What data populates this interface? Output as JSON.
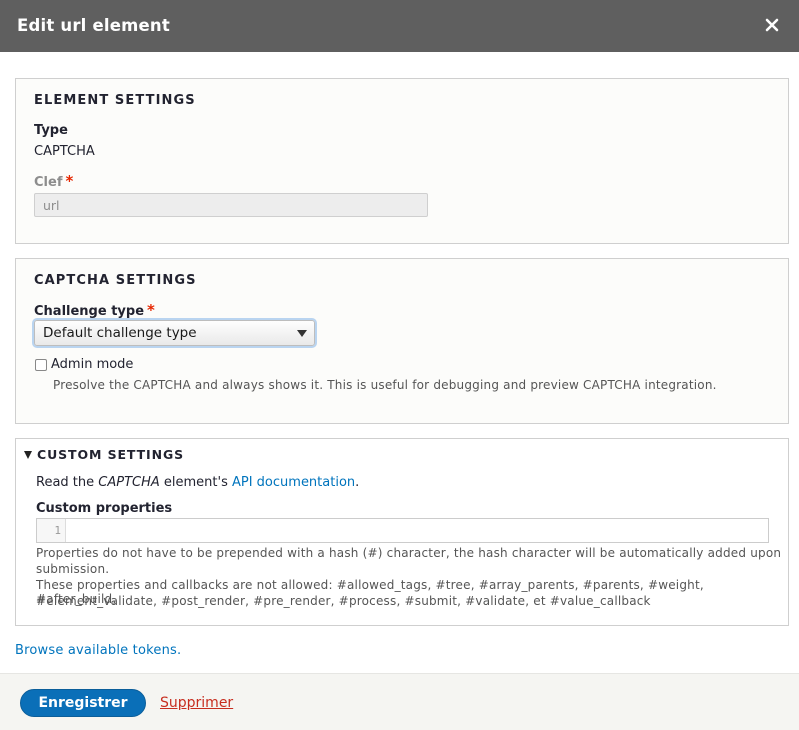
{
  "dialog": {
    "title": "Edit url element",
    "close_icon": "close-icon"
  },
  "element_settings": {
    "legend": "ELEMENT SETTINGS",
    "type_label": "Type",
    "type_value": "CAPTCHA",
    "key_label": "Clef",
    "key_required": "*",
    "key_value": "url"
  },
  "captcha_settings": {
    "legend": "CAPTCHA SETTINGS",
    "challenge_label": "Challenge type",
    "challenge_required": "*",
    "challenge_selected": "Default challenge type",
    "admin_mode_label": "Admin mode",
    "admin_mode_checked": false,
    "admin_mode_description": "Presolve the CAPTCHA and always shows it. This is useful for debugging and preview CAPTCHA integration."
  },
  "custom_settings": {
    "legend": "CUSTOM SETTINGS",
    "read_prefix": "Read the ",
    "read_element": "CAPTCHA",
    "read_middle": " element's ",
    "read_link": "API documentation",
    "read_suffix": ".",
    "properties_label": "Custom properties",
    "line_number": "1",
    "help_line1": "Properties do not have to be prepended with a hash (#) character, the hash character will be automatically added upon",
    "help_line2": "submission.",
    "help_line3": "These properties and callbacks are not allowed: #allowed_tags, #tree, #array_parents, #parents, #weight, #after_build,",
    "help_line4": "#element_validate, #post_render, #pre_render, #process, #submit, #validate, et #value_callback"
  },
  "tokens_link": "Browse available tokens.",
  "footer": {
    "save_label": "Enregistrer",
    "delete_label": "Supprimer"
  },
  "colors": {
    "titlebar": "#5f5f5f",
    "primary_button": "#0a6fb8",
    "link": "#0074bd",
    "required": "#e62600",
    "delete": "#c72d1f"
  }
}
